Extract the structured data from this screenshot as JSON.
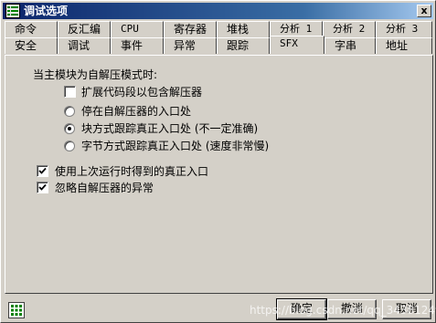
{
  "window": {
    "title": "调试选项",
    "close_glyph": "x"
  },
  "tabs_row1": [
    "命令",
    "反汇编",
    "CPU",
    "寄存器",
    "堆栈",
    "分析 1",
    "分析 2",
    "分析 3"
  ],
  "tabs_row2": [
    "安全",
    "调试",
    "事件",
    "异常",
    "跟踪",
    "SFX",
    "字串",
    "地址"
  ],
  "active_tab": "SFX",
  "sfx": {
    "heading": "当主模块为自解压模式时:",
    "extend_code": {
      "label": "扩展代码段以包含解压器",
      "checked": false
    },
    "radio_options": [
      {
        "label": "停在自解压器的入口处",
        "selected": false
      },
      {
        "label": "块方式跟踪真正入口处 (不一定准确)",
        "selected": true
      },
      {
        "label": "字节方式跟踪真正入口处 (速度非常慢)",
        "selected": false
      }
    ],
    "use_last_entry": {
      "label": "使用上次运行时得到的真正入口",
      "checked": true
    },
    "ignore_exceptions": {
      "label": "忽略自解压器的异常",
      "checked": true
    }
  },
  "buttons": {
    "ok": "确定",
    "undo": "撤消",
    "cancel": "取消"
  },
  "watermark": "https://blog.csdn.net/qq_34381249",
  "icons": {
    "title": "options-grid-icon",
    "status": "grid-icon"
  },
  "colors": {
    "title_start": "#0a246a",
    "title_end": "#a6caf0",
    "face": "#d4d0c8"
  }
}
